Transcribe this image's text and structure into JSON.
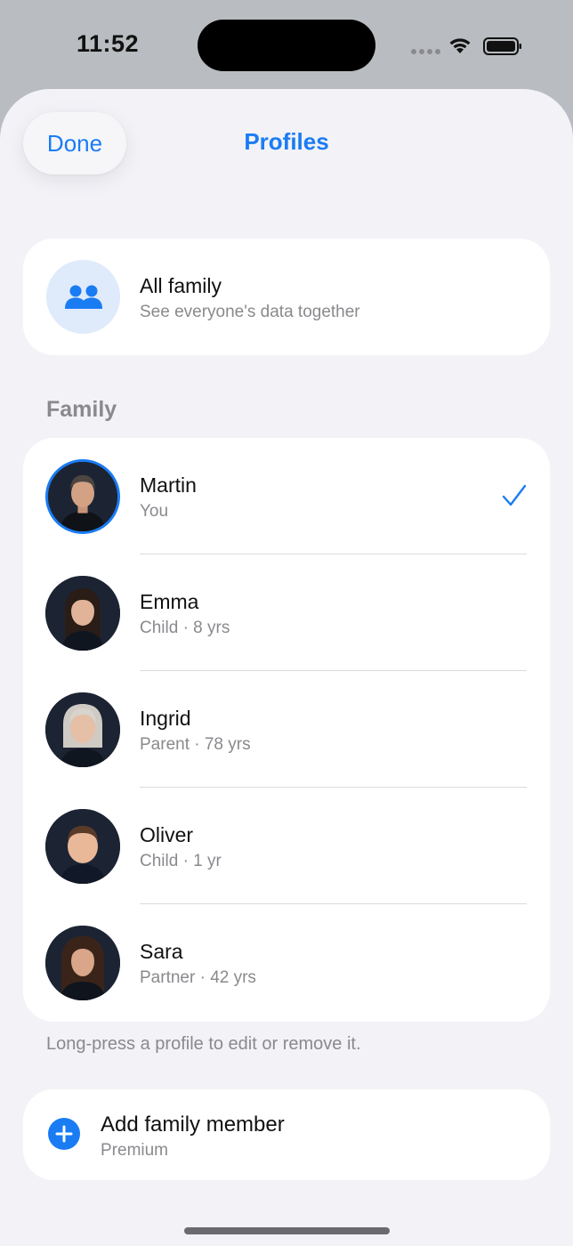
{
  "status_bar": {
    "time": "11:52"
  },
  "header": {
    "done_label": "Done",
    "title": "Profiles"
  },
  "all_family": {
    "title": "All family",
    "subtitle": "See everyone's data together",
    "icon": "people-icon"
  },
  "family_section": {
    "label": "Family",
    "members": [
      {
        "name": "Martin",
        "detail": "You",
        "selected": true
      },
      {
        "name": "Emma",
        "detail": "Child · 8 yrs",
        "selected": false
      },
      {
        "name": "Ingrid",
        "detail": "Parent · 78 yrs",
        "selected": false
      },
      {
        "name": "Oliver",
        "detail": "Child · 1 yr",
        "selected": false
      },
      {
        "name": "Sara",
        "detail": "Partner · 42 yrs",
        "selected": false
      }
    ]
  },
  "footer_note": "Long-press a profile to edit or remove it.",
  "add_member": {
    "title": "Add family member",
    "subtitle": "Premium",
    "icon": "plus-circle-icon"
  },
  "colors": {
    "accent": "#1a7cf3",
    "background": "#f2f2f7",
    "secondary_text": "#8a8a8e"
  }
}
